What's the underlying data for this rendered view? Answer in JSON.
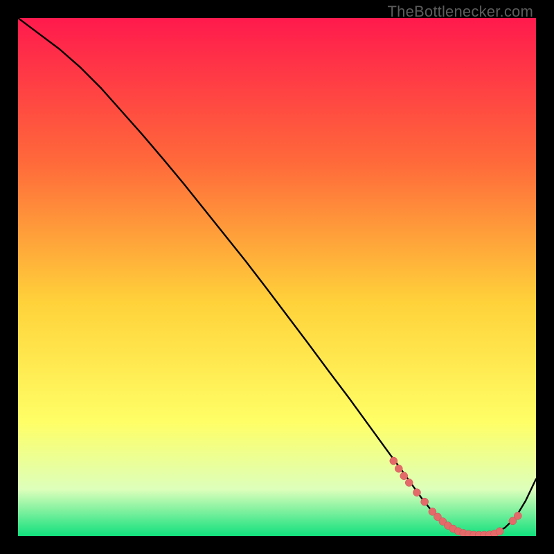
{
  "watermark": "TheBottlenecker.com",
  "colors": {
    "gradient_top": "#ff1a4d",
    "gradient_mid1": "#ff6a3a",
    "gradient_mid2": "#ffd23a",
    "gradient_mid3": "#ffff66",
    "gradient_mid4": "#ddffbb",
    "gradient_bottom": "#11e07d",
    "curve": "#000000",
    "dot_fill": "#e46a6a",
    "dot_stroke": "#c94f54"
  },
  "chart_data": {
    "type": "line",
    "title": "",
    "xlabel": "",
    "ylabel": "",
    "xlim": [
      0,
      100
    ],
    "ylim": [
      0,
      100
    ],
    "series": [
      {
        "name": "bottleneck-curve",
        "x": [
          0,
          4,
          8,
          12,
          16,
          20,
          24,
          28,
          32,
          36,
          40,
          44,
          48,
          52,
          56,
          60,
          64,
          68,
          72,
          74,
          76,
          78,
          80,
          82,
          84,
          86,
          88,
          90,
          92,
          94,
          96,
          98,
          100
        ],
        "y": [
          100,
          97,
          94,
          90.5,
          86.5,
          82,
          77.5,
          72.8,
          68,
          63,
          58,
          53,
          47.8,
          42.5,
          37.2,
          31.8,
          26.5,
          21,
          15.5,
          12.8,
          10,
          7.2,
          4.7,
          2.7,
          1.3,
          0.5,
          0.2,
          0.2,
          0.5,
          1.6,
          3.5,
          6.8,
          11
        ]
      }
    ],
    "dots": {
      "name": "highlighted-points",
      "x": [
        72.5,
        73.5,
        74.5,
        75.5,
        77,
        78.5,
        80,
        81,
        82,
        83,
        84,
        85,
        86,
        87,
        88,
        89,
        90,
        91,
        92,
        93,
        95.5,
        96.5
      ],
      "y": [
        14.5,
        13.0,
        11.6,
        10.3,
        8.4,
        6.6,
        4.7,
        3.7,
        2.8,
        2.0,
        1.4,
        0.9,
        0.55,
        0.35,
        0.22,
        0.2,
        0.2,
        0.25,
        0.45,
        0.9,
        2.9,
        3.9
      ]
    }
  }
}
